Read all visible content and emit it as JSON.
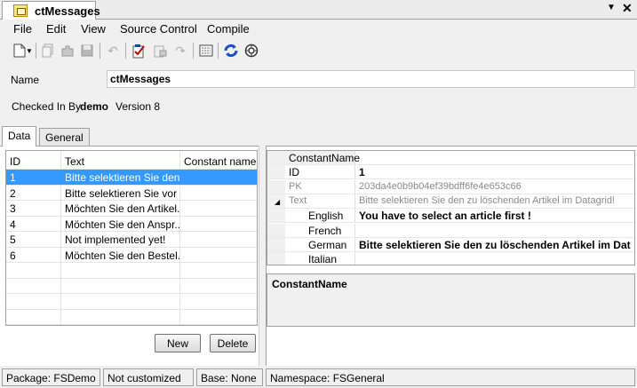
{
  "document": {
    "tab_title": "ctMessages",
    "dropdown": "▼",
    "close": "✕"
  },
  "menu": [
    "File",
    "Edit",
    "View",
    "Source Control",
    "Compile"
  ],
  "form": {
    "name_label": "Name",
    "name_value": "ctMessages",
    "checked_in_label": "Checked In By",
    "checked_in_user": "demo",
    "version": "Version 8"
  },
  "tabs": {
    "data": "Data",
    "general": "General"
  },
  "grid": {
    "columns": [
      "ID",
      "Text",
      "Constant name"
    ],
    "rows": [
      {
        "id": "1",
        "text": "Bitte selektieren Sie den...",
        "constant": ""
      },
      {
        "id": "2",
        "text": "Bitte selektieren Sie vor ...",
        "constant": ""
      },
      {
        "id": "3",
        "text": "Möchten Sie den Artikel...",
        "constant": ""
      },
      {
        "id": "4",
        "text": "Möchten Sie den Anspr...",
        "constant": ""
      },
      {
        "id": "5",
        "text": "Not implemented yet!",
        "constant": ""
      },
      {
        "id": "6",
        "text": "Möchten Sie den Bestel...",
        "constant": ""
      }
    ],
    "selected_index": 0
  },
  "buttons": {
    "new": "New",
    "delete": "Delete"
  },
  "property_grid": {
    "header": "ConstantName",
    "expander": "◢",
    "rows": [
      {
        "label": "ID",
        "value": "1"
      },
      {
        "label": "PK",
        "value": "203da4e0b9b04ef39bdff6fe4e653c66"
      },
      {
        "label": "Text",
        "value": "Bitte selektieren Sie den zu löschenden Artikel im Datagrid!"
      },
      {
        "label": "English",
        "value": "You have to select an article first !"
      },
      {
        "label": "French",
        "value": ""
      },
      {
        "label": "German",
        "value": "Bitte selektieren Sie den zu löschenden Artikel im Dat"
      },
      {
        "label": "Italian",
        "value": ""
      }
    ],
    "description": "ConstantName"
  },
  "status": {
    "package": "Package: FSDemo",
    "customized": "Not customized",
    "base": "Base: None",
    "namespace": "Namespace: FSGeneral"
  },
  "icons": [
    "new-document-icon",
    "dropdown-arrow-icon",
    "copy-icon",
    "plugin-icon",
    "save-icon",
    "undo-icon",
    "checkin-icon",
    "checkout-icon",
    "revert-icon",
    "compile-icon",
    "refresh-icon",
    "settings-icon"
  ],
  "colors": {
    "selection": "#3399ff",
    "panel": "#f0f0f0"
  }
}
